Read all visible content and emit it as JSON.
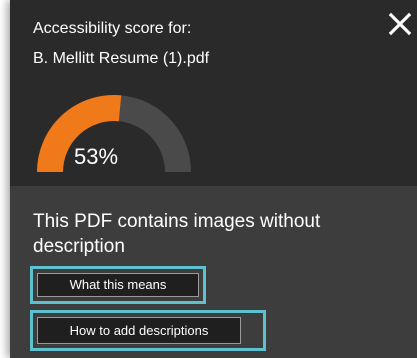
{
  "popup": {
    "heading": "Accessibility score for:",
    "file_name": "B. Mellitt Resume (1).pdf",
    "close_icon": "close-icon",
    "score": {
      "value": 53,
      "label": "53%"
    },
    "message": "This PDF contains images without description",
    "buttons": {
      "what_this_means": "What this means",
      "how_to_add": "How to add descriptions"
    }
  },
  "colors": {
    "gauge_fill": "#f07a1a",
    "gauge_track": "#4a4a4a",
    "highlight": "#5ec1cf",
    "panel_upper": "#2a2a2a",
    "panel_lower": "#3d3d3d"
  }
}
